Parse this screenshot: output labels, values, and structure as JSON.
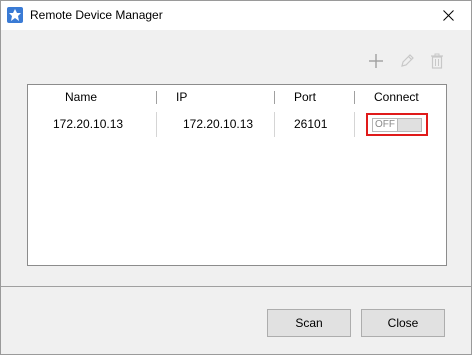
{
  "window": {
    "title": "Remote Device Manager",
    "accent_color": "#3a7bd5"
  },
  "toolbar": {
    "add_icon": "plus-icon",
    "edit_icon": "pencil-icon",
    "delete_icon": "trash-icon"
  },
  "table": {
    "columns": [
      "Name",
      "IP",
      "Port",
      "Connect"
    ],
    "rows": [
      {
        "name": "172.20.10.13",
        "ip": "172.20.10.13",
        "port": "26101",
        "connect": "OFF"
      }
    ],
    "highlight_color": "#e01a1a"
  },
  "buttons": {
    "scan_label": "Scan",
    "close_label": "Close"
  }
}
